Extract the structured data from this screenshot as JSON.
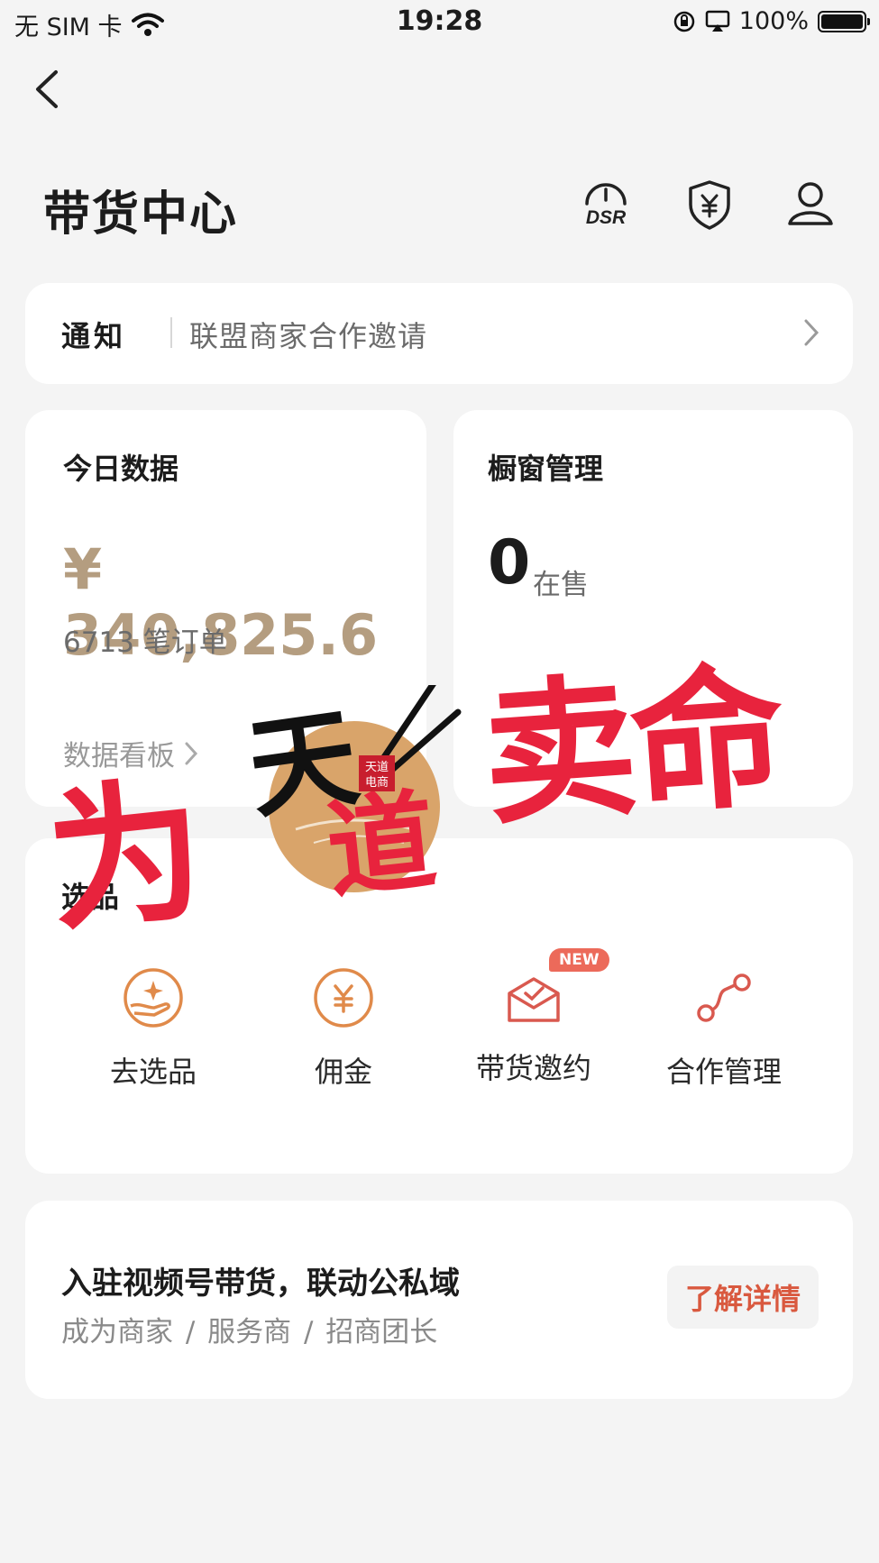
{
  "status_bar": {
    "carrier": "无 SIM 卡",
    "time": "19:28",
    "battery": "100%",
    "battery_level": 1.0
  },
  "header": {
    "title": "带货中心",
    "icons": [
      "back-arrow-icon",
      "dsr-gauge-icon",
      "yuan-shield-icon",
      "user-icon"
    ],
    "dsr_label": "DSR"
  },
  "notice": {
    "label": "通知",
    "text": "联盟商家合作邀请"
  },
  "today": {
    "label": "今日数据",
    "amount": "¥ 340,825.6",
    "orders": "6713 笔订单",
    "link": "数据看板"
  },
  "showcase": {
    "label": "橱窗管理",
    "count": "0",
    "unit": "在售"
  },
  "tools": {
    "label": "选品",
    "items": [
      {
        "label": "去选品",
        "icon": "hand-star-icon"
      },
      {
        "label": "佣金",
        "icon": "yuan-circle-icon"
      },
      {
        "label": "带货邀约",
        "icon": "envelope-check-icon",
        "badge": "NEW"
      },
      {
        "label": "合作管理",
        "icon": "connection-icon"
      }
    ]
  },
  "promo": {
    "title": "入驻视频号带货，联动公私域",
    "subtitle": "成为商家 / 服务商 / 招商团长",
    "button": "了解详情"
  },
  "watermark": {
    "left_text": "为",
    "right_text": "卖命",
    "logo_text": "天道",
    "seal_text": "天道电商"
  },
  "colors": {
    "accent_gold": "#b49d80",
    "accent_orange": "#e08a4a",
    "accent_red": "#d9593f",
    "watermark_red": "#e8233d"
  }
}
